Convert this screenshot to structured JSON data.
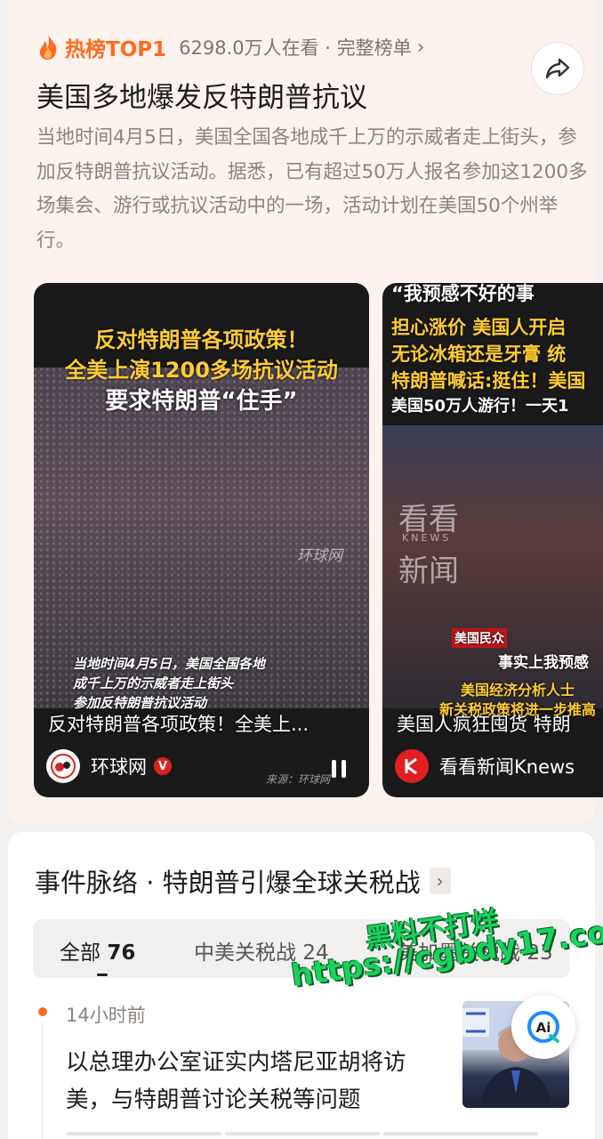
{
  "hot": {
    "badge": "热榜TOP1",
    "meta": "6298.0万人在看 · 完整榜单",
    "chevron": "›"
  },
  "headline": "美国多地爆发反特朗普抗议",
  "summary": "当地时间4月5日，美国全国各地成千上万的示威者走上街头，参加反特朗普抗议活动。据悉，已有超过50万人报名参加这1200多场集会、游行或抗议活动中的一场，活动计划在美国50个州举行。",
  "videos": [
    {
      "cap1": "反对特朗普各项政策！",
      "cap2": "全美上演1200多场抗议活动",
      "cap3": "要求特朗普“住手”",
      "watermark": "环球网",
      "sub1": "当地时间4月5日，美国全国各地",
      "sub2": "成千上万的示威者走上街头",
      "sub3": "参加反特朗普抗议活动",
      "title": "反对特朗普各项政策！全美上...",
      "author": "环球网",
      "badge": "V",
      "source": "来源：环球网"
    },
    {
      "cap0": "“我预感不好的事",
      "cap1": "担心涨价 美国人开启",
      "cap2": "无论冰箱还是牙膏 统",
      "cap3": "特朗普喊话:挺住！美国",
      "cap4": "美国50万人游行！一天1",
      "wm1": "看看",
      "wm2": "KNEWS",
      "wm3": "新闻",
      "label1": "美国民众",
      "label2": "事实上我预感",
      "label3": "美国经济分析人士",
      "label4": "新关税政策将进一步推高",
      "title": "美国人疯狂囤货 特朗",
      "author": "看看新闻Knews"
    }
  ],
  "events": {
    "title": "事件脉络 · 特朗普引爆全球关税战",
    "chevron": "›",
    "tabs": [
      {
        "label": "全部",
        "count": "76"
      },
      {
        "label": "中美关税战",
        "count": "24"
      },
      {
        "label": "美加墨关税战",
        "count": "23"
      }
    ],
    "item": {
      "time": "14小时前",
      "text": "以总理办公室证实内塔尼亚胡将访美，与特朗普讨论关税等问题"
    }
  },
  "overlay": {
    "line1": "黑料不打烊",
    "line2": "https://cgbdy17.com"
  },
  "ai_button": "Ai",
  "colors": {
    "accent": "#ff6a1f",
    "watermark": "#19d25e"
  }
}
